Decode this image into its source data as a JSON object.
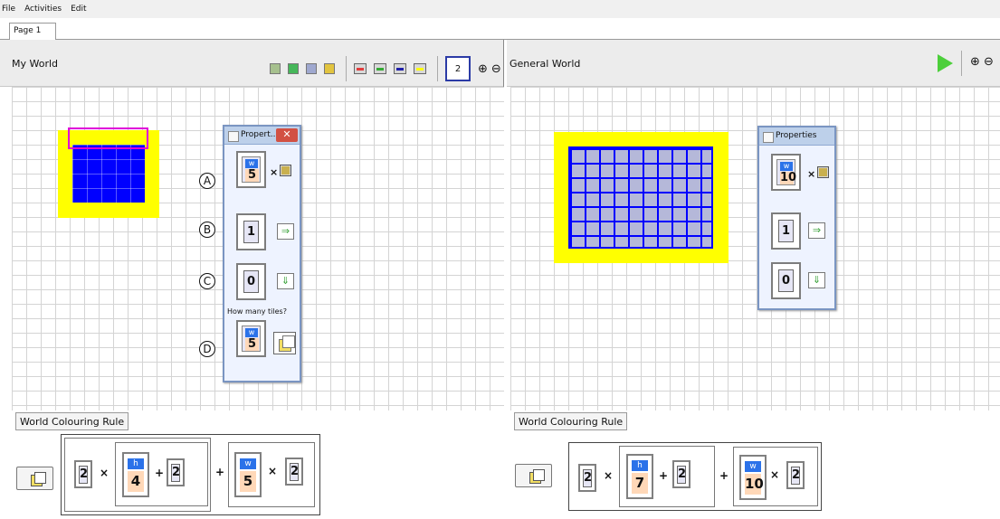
{
  "menu": [
    "File",
    "Activities",
    "Edit"
  ],
  "tab": "Page 1",
  "left": {
    "title": "My World",
    "color_tools": [
      "gray-green",
      "green",
      "gray-blue",
      "gold",
      "red-bar",
      "green-bar",
      "blue-bar",
      "yellow-bar"
    ],
    "number_box": "2",
    "properties_title": "Propert...",
    "a": "5",
    "b": "1",
    "c": "0",
    "how_many": "How many tiles?",
    "d": "5",
    "circles": [
      "A",
      "B",
      "C",
      "D"
    ],
    "rule_label": "World Colouring Rule",
    "rule": [
      "2",
      "×",
      "h",
      "4",
      "+",
      "2",
      "+",
      "w",
      "5",
      "×",
      "2"
    ]
  },
  "right": {
    "title": "General World",
    "properties_title": "Properties",
    "a": "10",
    "b": "1",
    "c": "0",
    "rule_label": "World Colouring Rule",
    "rule": [
      "2",
      "×",
      "h",
      "7",
      "+",
      "2",
      "+",
      "w",
      "10",
      "×",
      "2"
    ]
  },
  "letters": {
    "w": "w",
    "h": "h"
  }
}
